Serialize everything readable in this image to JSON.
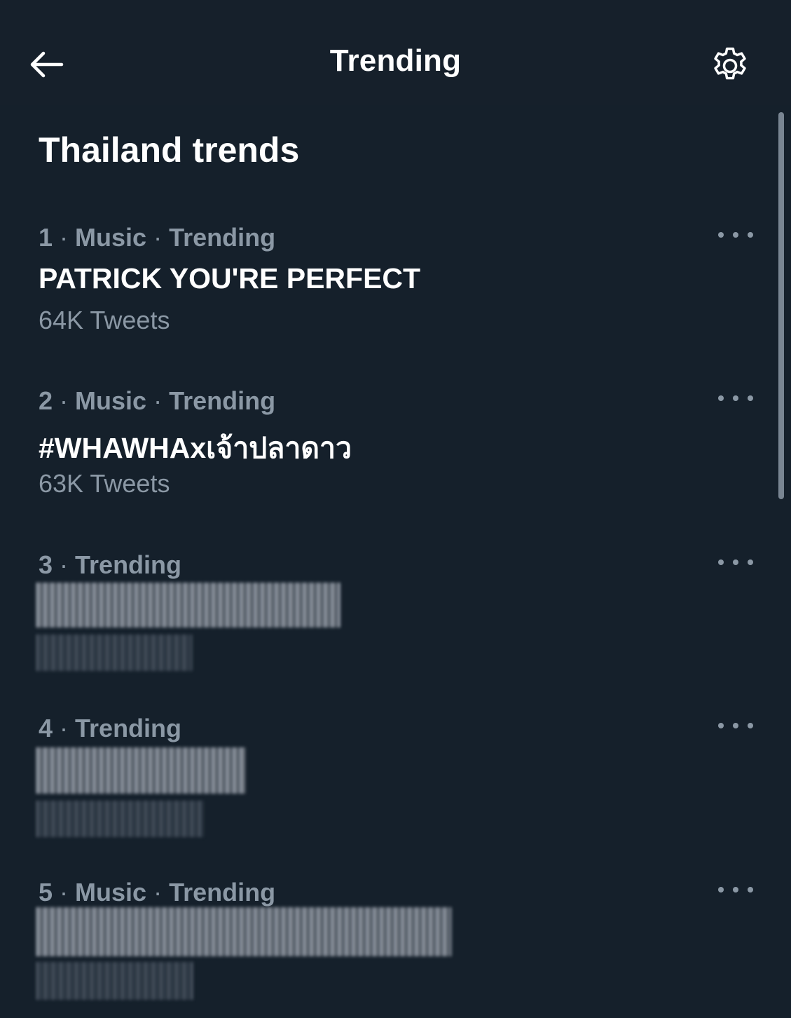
{
  "header": {
    "title": "Trending",
    "back_icon": "arrow-left-icon",
    "settings_icon": "gear-icon"
  },
  "section": {
    "title": "Thailand trends"
  },
  "trends": [
    {
      "rank": "1",
      "meta_parts": [
        "Music",
        "Trending"
      ],
      "name": "PATRICK YOU'RE PERFECT",
      "count": "64K Tweets",
      "redacted": false
    },
    {
      "rank": "2",
      "meta_parts": [
        "Music",
        "Trending"
      ],
      "name": "#WHAWHAxเจ้าปลาดาว",
      "count": "63K Tweets",
      "redacted": false
    },
    {
      "rank": "3",
      "meta_parts": [
        "Trending"
      ],
      "name": "",
      "count": "",
      "redacted": true
    },
    {
      "rank": "4",
      "meta_parts": [
        "Trending"
      ],
      "name": "",
      "count": "",
      "redacted": true
    },
    {
      "rank": "5",
      "meta_parts": [
        "Music",
        "Trending"
      ],
      "name": "",
      "count": "",
      "redacted": true
    }
  ],
  "colors": {
    "background": "#15202b",
    "primary_text": "#ffffff",
    "secondary_text": "#8b98a5"
  }
}
